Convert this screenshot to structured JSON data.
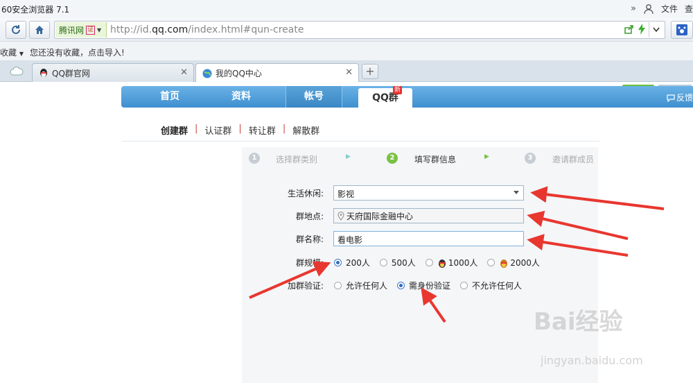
{
  "browser": {
    "title": "60安全浏览器 7.1",
    "right_menu": {
      "more": "»",
      "file": "文件",
      "extra": "查"
    },
    "site_name": "腾讯网",
    "cert_label": "证",
    "url_prefix": "http://id.",
    "url_domain": "qq.com",
    "url_suffix": "/index.html#qun-create",
    "bookmarks_label": "收藏",
    "bookmarks_hint": "您还没有收藏，点击导入!",
    "tabs": [
      {
        "label": "QQ群官网",
        "active": false
      },
      {
        "label": "我的QQ中心",
        "active": true
      }
    ],
    "new_tab": "+"
  },
  "page": {
    "menu": [
      "首页",
      "资料",
      "帐号",
      "QQ群"
    ],
    "new_badge": "新",
    "feedback": "反馈",
    "subnav": [
      "创建群",
      "认证群",
      "转让群",
      "解散群"
    ],
    "subnav_sep": "|",
    "steps": [
      {
        "num": "1",
        "label": "选择群类别"
      },
      {
        "num": "2",
        "label": "填写群信息"
      },
      {
        "num": "3",
        "label": "邀请群成员"
      }
    ],
    "form": {
      "category_label": "生活休闲:",
      "category_value": "影视",
      "location_label": "群地点:",
      "location_value": "天府国际金融中心",
      "name_label": "群名称:",
      "name_value": "看电影",
      "size_label": "群规模:",
      "size_options": [
        "200人",
        "500人",
        "1000人",
        "2000人"
      ],
      "verify_label": "加群验证:",
      "verify_options": [
        "允许任何人",
        "需身份验证",
        "不允许任何人"
      ]
    },
    "watermark": "Bai经验",
    "watermark_url": "jingyan.baidu.com"
  }
}
